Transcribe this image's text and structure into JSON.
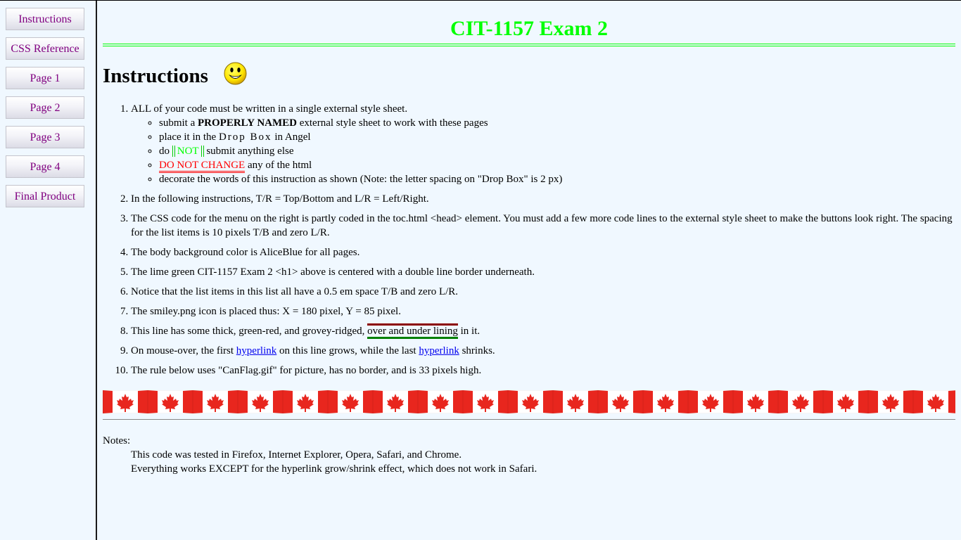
{
  "toc": {
    "items": [
      {
        "label": "Instructions"
      },
      {
        "label": "CSS Reference"
      },
      {
        "label": "Page 1"
      },
      {
        "label": "Page 2"
      },
      {
        "label": "Page 3"
      },
      {
        "label": "Page 4"
      },
      {
        "label": "Final Product"
      }
    ]
  },
  "header": {
    "title": "CIT-1157 Exam 2"
  },
  "instructions": {
    "heading": "Instructions",
    "smiley_icon": "smiley-face-icon",
    "item1": {
      "text": "ALL of your code must be written in a single external style sheet.",
      "sub1_pre": "submit a ",
      "sub1_bold": "PROPERLY NAMED",
      "sub1_post": " external style sheet to work with these pages",
      "sub2_pre": "place it in the ",
      "sub2_spaced": "Drop Box",
      "sub2_post": " in Angel",
      "sub3_pre": "do ",
      "sub3_not": "NOT",
      "sub3_post": " submit anything else",
      "sub4_red": "DO NOT CHANGE",
      "sub4_post": " any of the html",
      "sub5": "decorate the words of this instruction as shown (Note: the letter spacing on \"Drop Box\" is 2 px)"
    },
    "item2": "In the following instructions, T/R = Top/Bottom and L/R = Left/Right.",
    "item3": "The CSS code for the menu on the right is partly coded in the toc.html <head> element. You must add a few more code lines to the external style sheet to make the buttons look right. The spacing for the list items is 10 pixels T/B and zero L/R.",
    "item4": "The body background color is AliceBlue for all pages.",
    "item5": "The lime green CIT-1157 Exam 2 <h1> above is centered with a double line border underneath.",
    "item6": "Notice that the list items in this list all have a 0.5 em space T/B and zero L/R.",
    "item7": "The smiley.png icon is placed thus: X = 180 pixel, Y = 85 pixel.",
    "item8": {
      "pre": "This line has some thick, green-red, and grovey-ridged, ",
      "lined": "over and under lining",
      "post": " in it."
    },
    "item9": {
      "pre": "On mouse-over, the first ",
      "link1": "hyperlink",
      "mid": " on this line grows, while the last ",
      "link2": "hyperlink",
      "post": " shrinks."
    },
    "item10": "The rule below uses \"CanFlag.gif\" for picture, has no border, and is 33 pixels high."
  },
  "flag_rule": {
    "icon": "canadian-flag-icon",
    "colors": {
      "red": "#E8261E",
      "white": "#FFFFFF"
    }
  },
  "notes": {
    "label": "Notes:",
    "line1": "This code was tested in Firefox, Internet Explorer, Opera, Safari, and Chrome.",
    "line2": "Everything works EXCEPT for the hyperlink grow/shrink effect, which does not work in Safari."
  },
  "colors": {
    "background": "#F0F8FF",
    "title": "#00FF00",
    "toc_link": "#800080",
    "hyperlink": "#0000EE",
    "warning": "#FF0000"
  }
}
